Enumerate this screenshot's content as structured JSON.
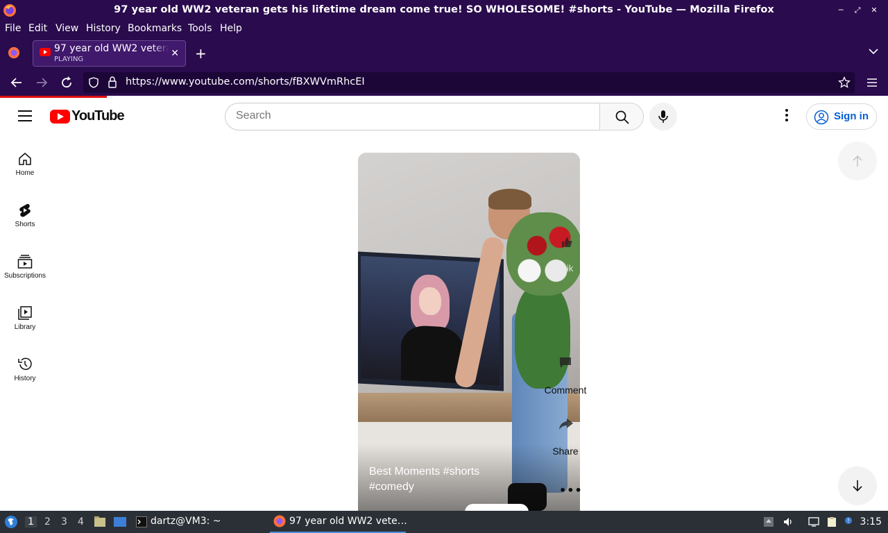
{
  "window": {
    "title": "97 year old WW2 veteran gets his lifetime dream come true! SO WHOLESOME! #shorts - YouTube — Mozilla Firefox",
    "controls": [
      "minimize",
      "maximize",
      "close"
    ]
  },
  "menu": {
    "items": [
      "File",
      "Edit",
      "View",
      "History",
      "Bookmarks",
      "Tools",
      "Help"
    ]
  },
  "tabs": [
    {
      "title": "97 year old WW2 veteran gets his lifetime dream come true! SO WHOLESOME! #shorts - YouTube",
      "status": "PLAYING"
    }
  ],
  "navbar": {
    "url": "https://www.youtube.com/shorts/fBXWVmRhcEI"
  },
  "youtube": {
    "logo_text": "YouTube",
    "search_placeholder": "Search",
    "sign_in": "Sign in",
    "guide": [
      {
        "label": "Home",
        "icon": "home-icon"
      },
      {
        "label": "Shorts",
        "icon": "shorts-icon"
      },
      {
        "label": "Subscriptions",
        "icon": "subscriptions-icon"
      },
      {
        "label": "Library",
        "icon": "library-icon"
      },
      {
        "label": "History",
        "icon": "history-icon"
      }
    ],
    "short": {
      "caption_line1": "Best Moments #shorts",
      "caption_line2": "#comedy",
      "actions": {
        "like_partial": "Lik",
        "comment": "Comment",
        "share": "Share",
        "more": "..."
      }
    }
  },
  "taskbar": {
    "workspaces": [
      "1",
      "2",
      "3",
      "4"
    ],
    "active_workspace": "1",
    "tasks": [
      {
        "label": "dartz@VM3: ~",
        "icon": "terminal-icon"
      },
      {
        "label": "97 year old WW2 vete…",
        "icon": "firefox-icon"
      }
    ],
    "clock": "3:15"
  },
  "colors": {
    "firefox_chrome": "#2a0b4d",
    "youtube_red": "#ff0000",
    "signin_blue": "#065fd4",
    "taskbar": "#2b3036"
  }
}
